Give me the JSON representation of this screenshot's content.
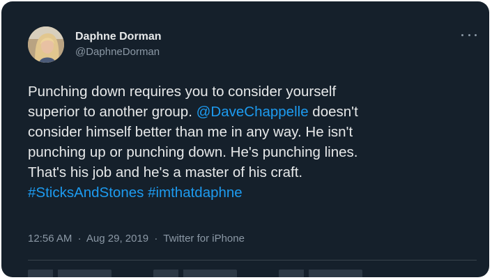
{
  "tweet": {
    "author": {
      "display_name": "Daphne Dorman",
      "handle": "@DaphneDorman"
    },
    "lines": [
      [
        {
          "text": "Punching down requires you to consider yourself",
          "type": "text"
        }
      ],
      [
        {
          "text": "superior to another group. ",
          "type": "text"
        },
        {
          "text": "@DaveChappelle",
          "type": "mention"
        },
        {
          "text": " doesn't",
          "type": "text"
        }
      ],
      [
        {
          "text": "consider himself better than me in any way. He isn't",
          "type": "text"
        }
      ],
      [
        {
          "text": "punching up or punching down. He's punching lines.",
          "type": "text"
        }
      ],
      [
        {
          "text": "That's his job and he's a master of his craft.",
          "type": "text"
        }
      ],
      [
        {
          "text": "#SticksAndStones",
          "type": "hashtag"
        },
        {
          "text": " ",
          "type": "text"
        },
        {
          "text": "#imthatdaphne",
          "type": "hashtag"
        }
      ]
    ],
    "time": "12:56 AM",
    "date": "Aug 29, 2019",
    "separator": "·",
    "source": "Twitter for iPhone"
  },
  "icons": {
    "more": "more-options-icon"
  },
  "colors": {
    "background": "#15202b",
    "text": "#e7e9ea",
    "secondary": "#8b98a5",
    "link": "#1d9bf0",
    "divider": "#38444d"
  }
}
